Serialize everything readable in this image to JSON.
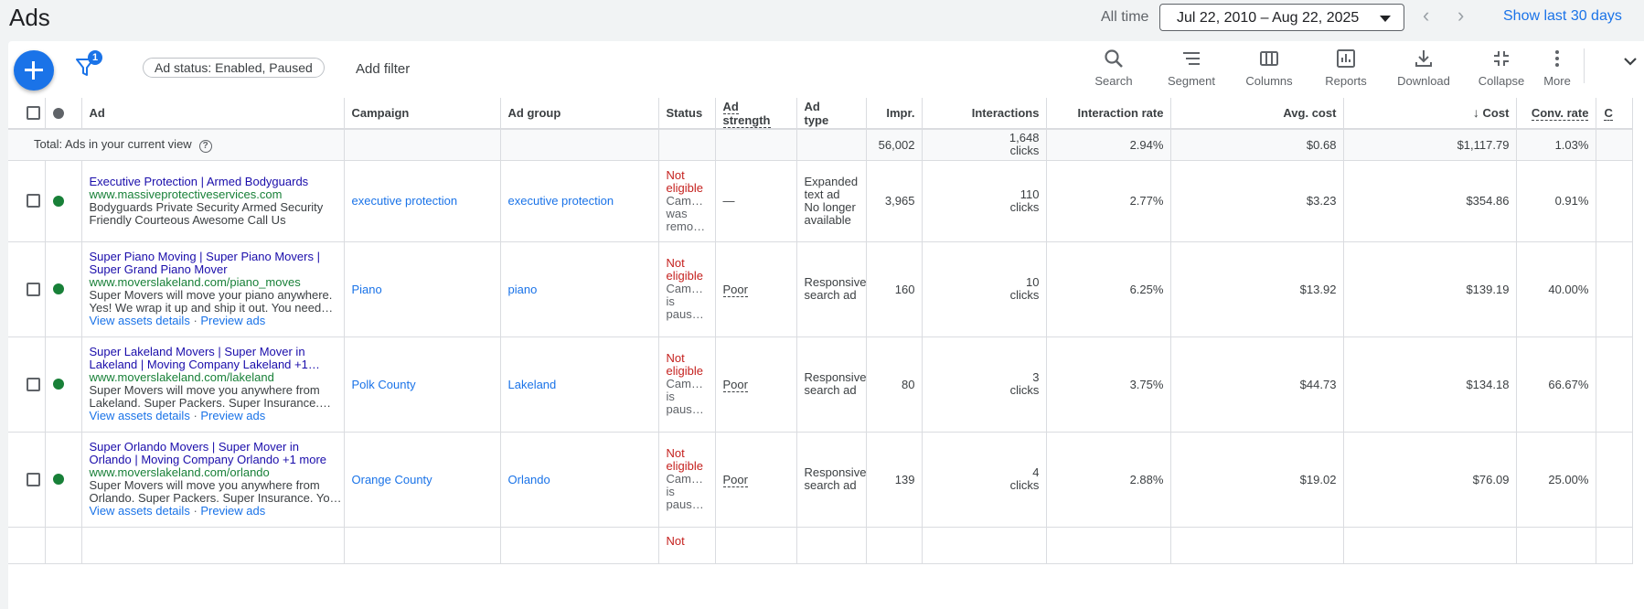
{
  "header": {
    "title": "Ads",
    "all_time_label": "All time",
    "date_range": "Jul 22, 2010 – Aug 22, 2025",
    "show_last_label": "Show last 30 days"
  },
  "toolbar": {
    "filter_count": "1",
    "filter_chip": "Ad status: Enabled, Paused",
    "add_filter": "Add filter",
    "tools": [
      {
        "label": "Search",
        "icon": "search-icon"
      },
      {
        "label": "Segment",
        "icon": "segment-icon"
      },
      {
        "label": "Columns",
        "icon": "columns-icon"
      },
      {
        "label": "Reports",
        "icon": "reports-icon"
      },
      {
        "label": "Download",
        "icon": "download-icon"
      },
      {
        "label": "Collapse",
        "icon": "collapse-icon"
      },
      {
        "label": "More",
        "icon": "more-vert-icon"
      }
    ]
  },
  "table": {
    "columns": {
      "ad": "Ad",
      "campaign": "Campaign",
      "ad_group": "Ad group",
      "status": "Status",
      "ad_strength": "Ad strength",
      "ad_type_1": "Ad",
      "ad_type_2": "type",
      "impr": "Impr.",
      "interactions": "Interactions",
      "interaction_rate": "Interaction rate",
      "avg_cost": "Avg. cost",
      "cost": "Cost",
      "conv_rate": "Conv. rate",
      "next": "C"
    },
    "total": {
      "label": "Total: Ads in your current view",
      "impr": "56,002",
      "interactions_1": "1,648",
      "interactions_2": "clicks",
      "interaction_rate": "2.94%",
      "avg_cost": "$0.68",
      "cost": "$1,117.79",
      "conv_rate": "1.03%"
    },
    "rows": [
      {
        "headline_1": "Executive Protection | Armed Bodyguards",
        "headline_2": "",
        "url": "www.massiveprotectiveservices.com",
        "desc_1": "Bodyguards Private Security Armed Security",
        "desc_2": "Friendly Courteous Awesome Call Us",
        "links_1": "",
        "links_2": "",
        "campaign": "executive protection",
        "ad_group": "executive protection",
        "status_1": "Not",
        "status_2": "eligible",
        "status_3": "Cam…",
        "status_4": "was",
        "status_5": "remo…",
        "ad_strength": "—",
        "ad_type_1": "Expanded",
        "ad_type_2": "text ad",
        "ad_type_3": "No longer",
        "ad_type_4": "available",
        "impr": "3,965",
        "interactions_1": "110",
        "interactions_2": "clicks",
        "interaction_rate": "2.77%",
        "avg_cost": "$3.23",
        "cost": "$354.86",
        "conv_rate": "0.91%"
      },
      {
        "headline_1": "Super Piano Moving | Super Piano Movers |",
        "headline_2": "Super Grand Piano Mover",
        "url": "www.moverslakeland.com/piano_moves",
        "desc_1": "Super Movers will move your piano anywhere.",
        "desc_2": "Yes! We wrap it up and ship it out. You need…",
        "links_1": "View assets details",
        "links_2": "Preview ads",
        "campaign": "Piano",
        "ad_group": "piano",
        "status_1": "Not",
        "status_2": "eligible",
        "status_3": "Cam…",
        "status_4": "is",
        "status_5": "paus…",
        "ad_strength": "Poor",
        "ad_type_1": "Responsive",
        "ad_type_2": "search ad",
        "ad_type_3": "",
        "ad_type_4": "",
        "impr": "160",
        "interactions_1": "10",
        "interactions_2": "clicks",
        "interaction_rate": "6.25%",
        "avg_cost": "$13.92",
        "cost": "$139.19",
        "conv_rate": "40.00%"
      },
      {
        "headline_1": "Super Lakeland Movers | Super Mover in",
        "headline_2": "Lakeland | Moving Company Lakeland  +1…",
        "url": "www.moverslakeland.com/lakeland",
        "desc_1": "Super Movers will move you anywhere from",
        "desc_2": "Lakeland. Super Packers. Super Insurance.…",
        "links_1": "View assets details",
        "links_2": "Preview ads",
        "campaign": "Polk County",
        "ad_group": "Lakeland",
        "status_1": "Not",
        "status_2": "eligible",
        "status_3": "Cam…",
        "status_4": "is",
        "status_5": "paus…",
        "ad_strength": "Poor",
        "ad_type_1": "Responsive",
        "ad_type_2": "search ad",
        "ad_type_3": "",
        "ad_type_4": "",
        "impr": "80",
        "interactions_1": "3",
        "interactions_2": "clicks",
        "interaction_rate": "3.75%",
        "avg_cost": "$44.73",
        "cost": "$134.18",
        "conv_rate": "66.67%"
      },
      {
        "headline_1": "Super Orlando Movers | Super Mover in",
        "headline_2": "Orlando | Moving Company Orlando  +1 more",
        "url": "www.moverslakeland.com/orlando",
        "desc_1": "Super Movers will move you anywhere from",
        "desc_2": "Orlando. Super Packers. Super Insurance. Yo…",
        "links_1": "View assets details",
        "links_2": "Preview ads",
        "campaign": "Orange County",
        "ad_group": "Orlando",
        "status_1": "Not",
        "status_2": "eligible",
        "status_3": "Cam…",
        "status_4": "is",
        "status_5": "paus…",
        "ad_strength": "Poor",
        "ad_type_1": "Responsive",
        "ad_type_2": "search ad",
        "ad_type_3": "",
        "ad_type_4": "",
        "impr": "139",
        "interactions_1": "4",
        "interactions_2": "clicks",
        "interaction_rate": "2.88%",
        "avg_cost": "$19.02",
        "cost": "$76.09",
        "conv_rate": "25.00%"
      }
    ],
    "partial_status": "Not"
  }
}
